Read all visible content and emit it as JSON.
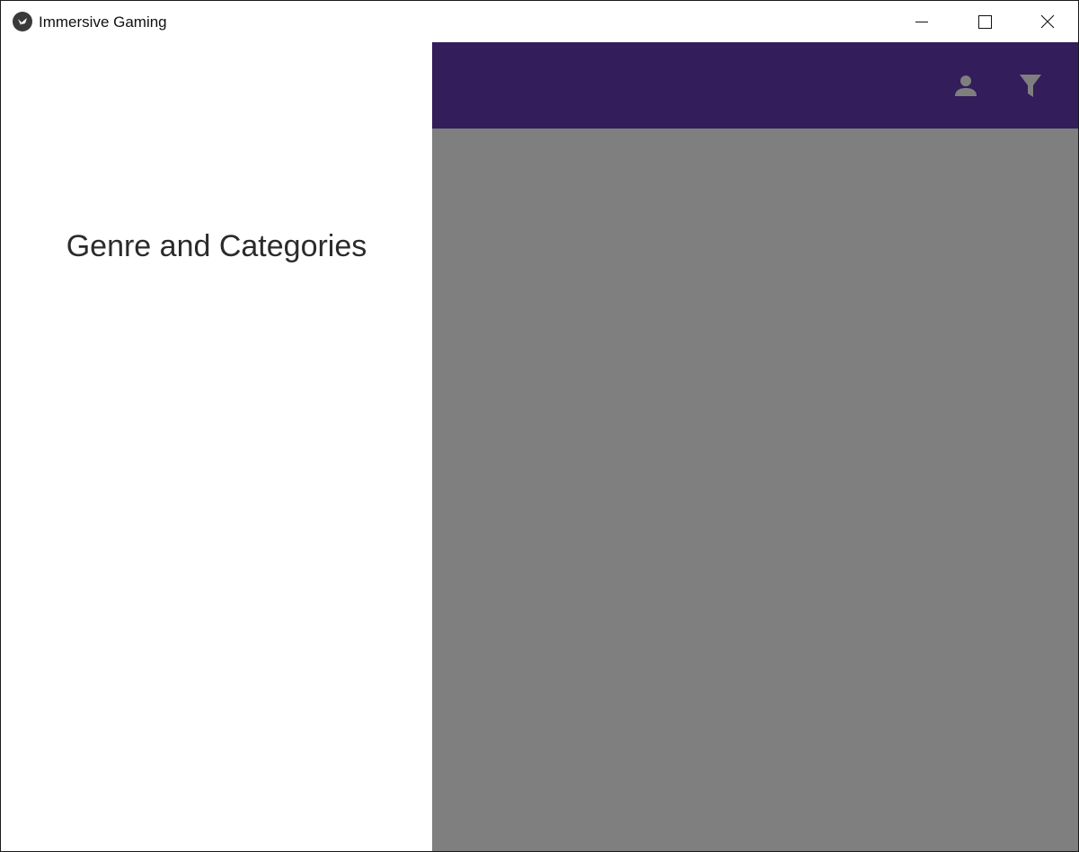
{
  "window": {
    "title": "Immersive Gaming",
    "icon": "kivy-logo-icon",
    "controls": [
      "minimize-icon",
      "maximize-icon",
      "close-icon"
    ]
  },
  "drawer": {
    "title": "Genre and Categories"
  },
  "toolbar": {
    "color": "#673ab7",
    "actions": [
      {
        "icon": "account-icon"
      },
      {
        "icon": "filter-icon"
      }
    ]
  },
  "overlay": {
    "color": "#000000",
    "opacity": 0.5
  }
}
